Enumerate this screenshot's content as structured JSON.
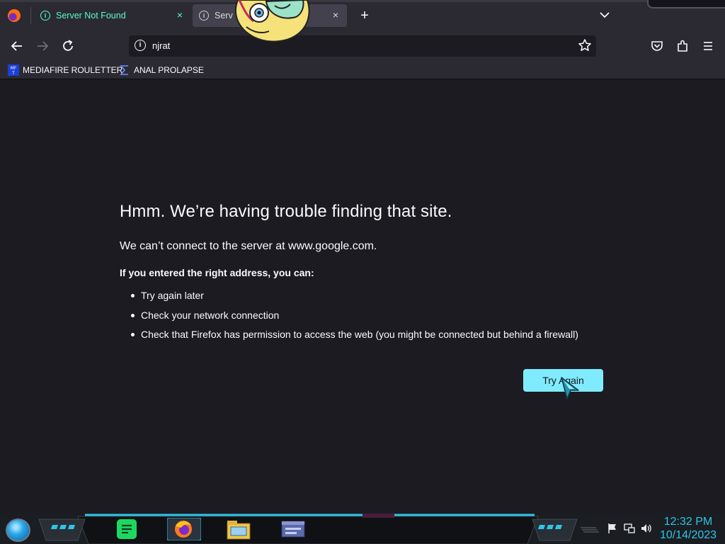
{
  "browser": {
    "tabs": [
      {
        "label": "Server Not Found",
        "close": "×"
      },
      {
        "label": "Serv",
        "close": "×"
      }
    ],
    "new_tab": "+",
    "url": "njrat",
    "bookmarks": [
      {
        "label": "MEDIAFIRE ROULETTER",
        "icon": "mediafire-icon"
      },
      {
        "label": "ANAL PROLAPSE",
        "icon": "sigma-icon"
      }
    ]
  },
  "error_page": {
    "title": "Hmm. We’re having trouble finding that site.",
    "subtitle": "We can’t connect to the server at www.google.com.",
    "hint": "If you entered the right address, you can:",
    "suggestions": [
      "Try again later",
      "Check your network connection",
      "Check that Firefox has permission to access the web (you might be connected but behind a firewall)"
    ],
    "button": "Try Again"
  },
  "taskbar": {
    "time": "12:32 PM",
    "date": "10/14/2023",
    "apps": [
      "spotify-icon",
      "firefox-icon",
      "file-explorer-icon",
      "window-app-icon"
    ]
  },
  "colors": {
    "accent": "#54ffbd",
    "button": "#80ebff",
    "background": "#1c1b22",
    "toolbar": "#2b2a33",
    "clock": "#2ec6e8"
  }
}
